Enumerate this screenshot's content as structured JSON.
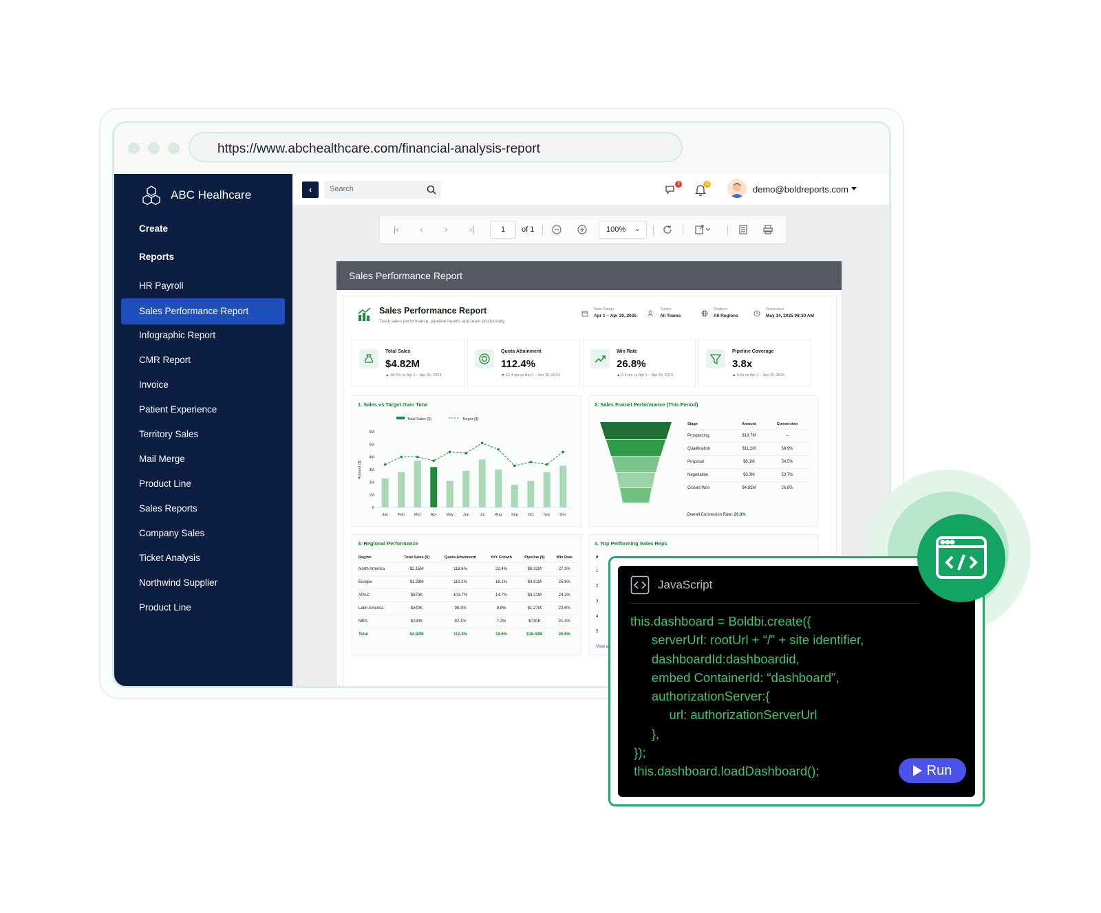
{
  "browser": {
    "url": "https://www.abchealthcare.com/financial-analysis-report"
  },
  "app": {
    "brand": "ABC Healhcare",
    "search_placeholder": "Search",
    "user_email": "demo@boldreports.com",
    "chat_badge": "3",
    "bell_badge": "15"
  },
  "sidebar": {
    "items": [
      {
        "label": "Create"
      },
      {
        "label": "Reports"
      },
      {
        "label": "HR Payroll"
      },
      {
        "label": "Sales Performance Report"
      },
      {
        "label": "Infographic Report"
      },
      {
        "label": "CMR Report"
      },
      {
        "label": "Invoice"
      },
      {
        "label": "Patient Experience"
      },
      {
        "label": "Territory Sales"
      },
      {
        "label": "Mail Merge"
      },
      {
        "label": "Product Line"
      },
      {
        "label": "Sales Reports"
      },
      {
        "label": "Company Sales"
      },
      {
        "label": "Ticket Analysis"
      },
      {
        "label": "Northwind Supplier"
      },
      {
        "label": "Product Line"
      }
    ]
  },
  "toolbar": {
    "page": "1",
    "of": "of 1",
    "zoom": "100%"
  },
  "report": {
    "bar_title": "Sales Performance Report",
    "title": "Sales Performance Report",
    "subtitle": "Track sales performance, pipeline health, and team productivity",
    "meta": [
      {
        "key": "Date Range",
        "value": "Apr 1 – Apr 30, 2025"
      },
      {
        "key": "Teams",
        "value": "All Teams"
      },
      {
        "key": "Regions",
        "value": "All Regions"
      },
      {
        "key": "Generated",
        "value": "May 14, 2025 08:30 AM"
      }
    ],
    "kpis": [
      {
        "label": "Total Sales",
        "value": "$4.82M",
        "delta": "18.6% vs Apr 1 – Apr 30, 2024",
        "dir": "up"
      },
      {
        "label": "Quota Attainment",
        "value": "112.4%",
        "delta": "12.4 pts vs Apr 1 – Apr 30, 2024",
        "dir": "down"
      },
      {
        "label": "Win Rate",
        "value": "26.8%",
        "delta": "2.6 pts vs Apr 1 – Apr 30, 2024",
        "dir": "up"
      },
      {
        "label": "Pipeline Coverage",
        "value": "3.8x",
        "delta": "0.6x vs Apr 1 – Apr 30, 2024",
        "dir": "up"
      }
    ],
    "panel1_title": "1. Sales vs Target Over Time",
    "panel2_title": "2. Sales Funnel Performance (This Period)",
    "panel3_title": "3. Regional Performance",
    "panel4_title": "4. Top Performing Sales Reps",
    "funnel": {
      "headers": [
        "Stage",
        "Amount",
        "Conversion"
      ],
      "rows": [
        [
          "Prospecting",
          "$18.7M",
          "–"
        ],
        [
          "Qualification",
          "$11.2M",
          "59.9%"
        ],
        [
          "Proposal",
          "$6.1M",
          "54.5%"
        ],
        [
          "Negotiation",
          "$3.3M",
          "53.7%"
        ],
        [
          "Closed Won",
          "$4.82M",
          "26.8%"
        ]
      ],
      "overall_label": "Overall Conversion Rate:",
      "overall_value": "26.8%"
    },
    "regional": {
      "headers": [
        "Region",
        "Total Sales ($)",
        "Quota Attainment",
        "YoY Growth",
        "Pipeline ($)",
        "Win Rate"
      ],
      "rows": [
        [
          "North America",
          "$2.15M",
          "118.6%",
          "22.4%",
          "$8.32M",
          "27.3%"
        ],
        [
          "Europe",
          "$1.28M",
          "110.2%",
          "16.1%",
          "$4.91M",
          "25.8%"
        ],
        [
          "APAC",
          "$870K",
          "103.7%",
          "14.7%",
          "$3.21M",
          "24.2%"
        ],
        [
          "Latin America",
          "$340K",
          "98.4%",
          "9.8%",
          "$1.27M",
          "23.6%"
        ],
        [
          "MEA",
          "$190K",
          "92.1%",
          "7.2%",
          "$730K",
          "21.4%"
        ]
      ],
      "total": [
        "Total",
        "$4.82M",
        "112.4%",
        "18.6%",
        "$18.43M",
        "26.8%"
      ]
    },
    "reps_header": "#",
    "reps_rows": [
      "1",
      "2",
      "3",
      "4",
      "5"
    ],
    "reps_link": "View all"
  },
  "chart_data": {
    "type": "bar",
    "categories": [
      "Jan",
      "Feb",
      "Mar",
      "Apr",
      "May",
      "Jun",
      "Jul",
      "Aug",
      "Sep",
      "Oct",
      "Nov",
      "Dec"
    ],
    "series": [
      {
        "name": "Total Sales ($)",
        "kind": "bar",
        "values": [
          2.3,
          2.8,
          3.7,
          3.2,
          2.1,
          2.9,
          3.8,
          3.0,
          1.8,
          2.1,
          2.8,
          3.3
        ]
      },
      {
        "name": "Target ($)",
        "kind": "line",
        "values": [
          3.4,
          4.0,
          4.0,
          3.7,
          4.4,
          4.3,
          5.1,
          4.6,
          3.3,
          3.6,
          3.4,
          4.4
        ]
      }
    ],
    "highlight_index": 3,
    "ylabel": "Amount ($)",
    "ylim": [
      0,
      6
    ],
    "yticks": [
      "0",
      "1M",
      "2M",
      "3M",
      "4M",
      "5M",
      "6M"
    ],
    "colors": {
      "bar": "#a9d9b4",
      "bar_highlight": "#1e8a3c",
      "line": "#1e8a3c"
    }
  },
  "code": {
    "language": "JavaScript",
    "lines": [
      "this.dashboard = Boldbi.create({",
      "      serverUrl: rootUrl + “/” + site identifier,",
      "      dashboardId:dashboardid,",
      "      embed ContainerId: “dashboard”,",
      "      authorizationServer:{",
      "           url: authorizationServerUrl",
      "      },",
      " });",
      " this.dashboard.loadDashboard();"
    ],
    "run_label": "Run"
  },
  "colors": {
    "sidebar": "#0c1e42",
    "active": "#1f4fbd",
    "accent_green": "#1fa968",
    "run": "#4b53e8"
  }
}
